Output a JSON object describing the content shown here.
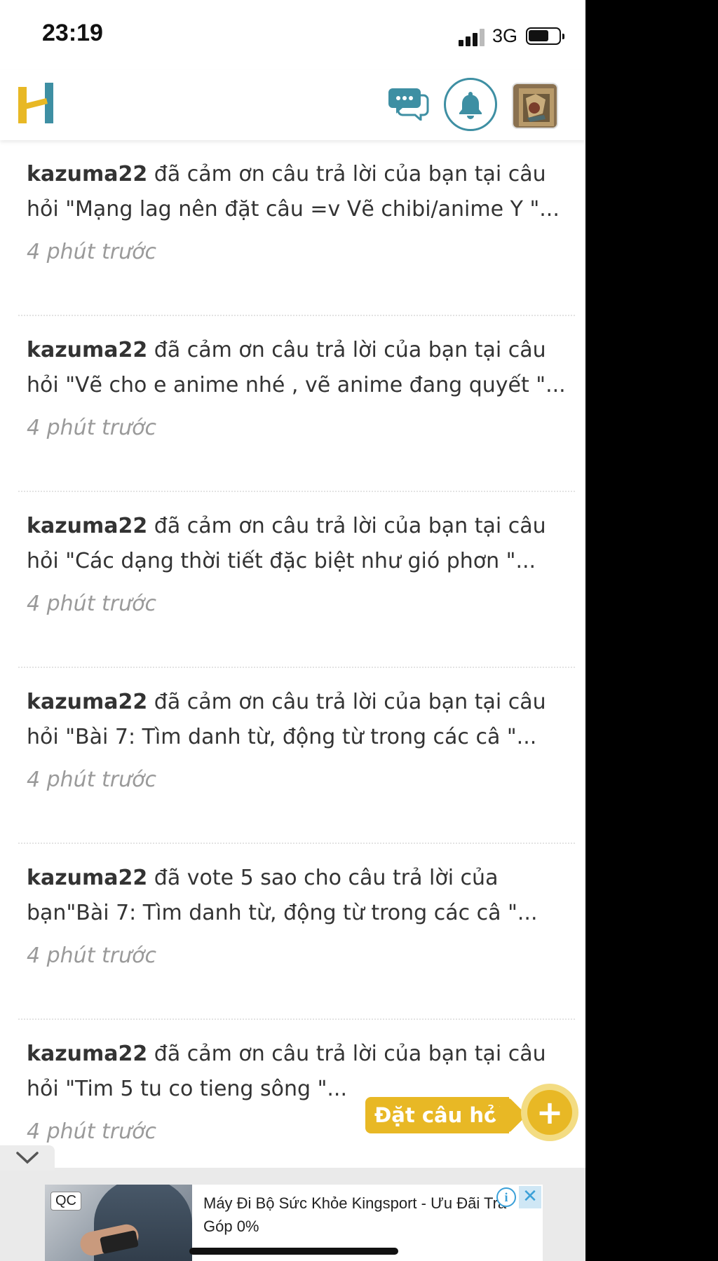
{
  "status_bar": {
    "time": "23:19",
    "network": "3G"
  },
  "header": {
    "logo_alt": "H",
    "colors": {
      "logo_yellow": "#e8b825",
      "logo_teal": "#3e8fa3",
      "bell": "#3e8fa3"
    },
    "icons": [
      "messages-icon",
      "bell-icon",
      "avatar"
    ]
  },
  "notifications": [
    {
      "user": "kazuma22",
      "text": " đã cảm ơn câu trả lời của bạn tại câu hỏi \"Mạng lag nên đặt câu =v Vẽ chibi/anime Y \"...",
      "time": "4 phút trước"
    },
    {
      "user": "kazuma22",
      "text": " đã cảm ơn câu trả lời của bạn tại câu hỏi \"Vẽ cho e anime nhé , vẽ anime đang quyết \"...",
      "time": "4 phút trước"
    },
    {
      "user": "kazuma22",
      "text": " đã cảm ơn câu trả lời của bạn tại câu hỏi \"Các dạng thời tiết đặc biệt như gió phơn \"...",
      "time": "4 phút trước"
    },
    {
      "user": "kazuma22",
      "text": " đã cảm ơn câu trả lời của bạn tại câu hỏi \"Bài 7: Tìm danh từ, động từ trong các câ \"...",
      "time": "4 phút trước"
    },
    {
      "user": "kazuma22",
      "text": "  đã vote 5 sao cho câu trả lời của bạn\"Bài 7: Tìm danh từ, động từ trong các câ \"...",
      "time": "4 phút trước"
    },
    {
      "user": "kazuma22",
      "text": " đã cảm ơn câu trả lời của bạn tại câu hỏi \"Tim 5 tu co tieng sông \"...",
      "time": "4 phút trước"
    }
  ],
  "ask_button": {
    "label": "Đặt câu hỏi",
    "plus": "+"
  },
  "ad": {
    "badge": "QC",
    "text": "Máy Đi Bộ Sức Khỏe Kingsport - Ưu Đãi Trả Góp 0%",
    "info": "i",
    "close": "✕"
  }
}
